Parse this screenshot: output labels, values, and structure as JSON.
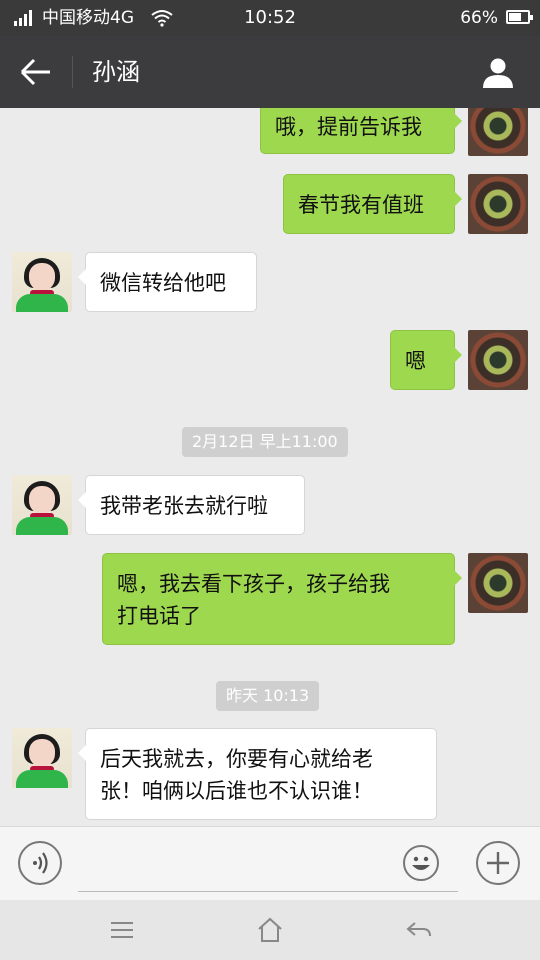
{
  "status_bar": {
    "carrier": "中国移动4G",
    "time": "10:52",
    "battery_percent": "66%",
    "battery_level": 0.66,
    "icons": [
      "signal-icon",
      "wifi-icon",
      "battery-icon"
    ]
  },
  "title_bar": {
    "title": "孙涵",
    "icons": [
      "back-arrow-icon",
      "profile-icon"
    ]
  },
  "messages": [
    {
      "side": "out",
      "text": "哦，提前告诉我"
    },
    {
      "side": "out",
      "text": "春节我有值班"
    },
    {
      "side": "in",
      "text": "微信转给他吧"
    },
    {
      "side": "out",
      "text": "嗯"
    },
    {
      "type": "timestamp",
      "text": "2月12日 早上11:00"
    },
    {
      "side": "in",
      "text": "我带老张去就行啦"
    },
    {
      "side": "out",
      "text": "嗯，我去看下孩子，孩子给我打电话了",
      "lines": [
        "嗯，我去看下孩子，孩子给我",
        "打电话了"
      ]
    },
    {
      "type": "timestamp",
      "text": "昨天 10:13"
    },
    {
      "side": "in",
      "text": "后天我就去，你要有心就给老张！咱俩以后谁也不认识谁！",
      "lines": [
        "后天我就去，你要有心就给老",
        "张！咱俩以后谁也不认识谁！"
      ]
    }
  ],
  "input_bar": {
    "value": "",
    "placeholder": "",
    "icons": [
      "voice-icon",
      "emoji-icon",
      "plus-icon"
    ]
  },
  "nav_bar": {
    "icons": [
      "menu-icon",
      "home-icon",
      "back-icon"
    ]
  },
  "colors": {
    "outgoing_bubble": "#9ed84e",
    "incoming_bubble": "#ffffff",
    "title_bar": "#3c3c3e",
    "chat_background": "#ebebeb"
  }
}
